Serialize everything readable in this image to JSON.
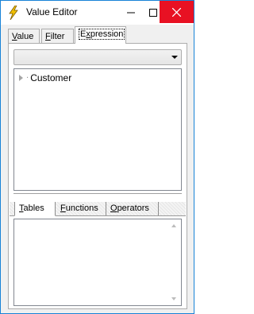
{
  "window": {
    "title": "Value Editor",
    "icon": "lightning-bolt-icon",
    "controls": {
      "minimize": "minimize-icon",
      "maximize": "maximize-icon",
      "close": "close-icon"
    },
    "close_color": "#e81123",
    "border_color": "#1883d7"
  },
  "tabs": {
    "value": {
      "mnemonic": "V",
      "rest": "alue"
    },
    "filter": {
      "mnemonic": "F",
      "rest": "ilter"
    },
    "expression": {
      "before": "E",
      "mnemonic": "x",
      "rest": "pression"
    },
    "active": "expression"
  },
  "expression_panel": {
    "combo_value": "",
    "tree": {
      "items": [
        {
          "label": "Customer",
          "collapsed": true
        }
      ]
    },
    "bottom_tabs": {
      "tables": {
        "mnemonic": "T",
        "rest": "ables"
      },
      "functions": {
        "mnemonic": "F",
        "rest": "unctions"
      },
      "operators": {
        "mnemonic": "O",
        "rest": "perators"
      },
      "active": "tables"
    },
    "list_items": []
  }
}
